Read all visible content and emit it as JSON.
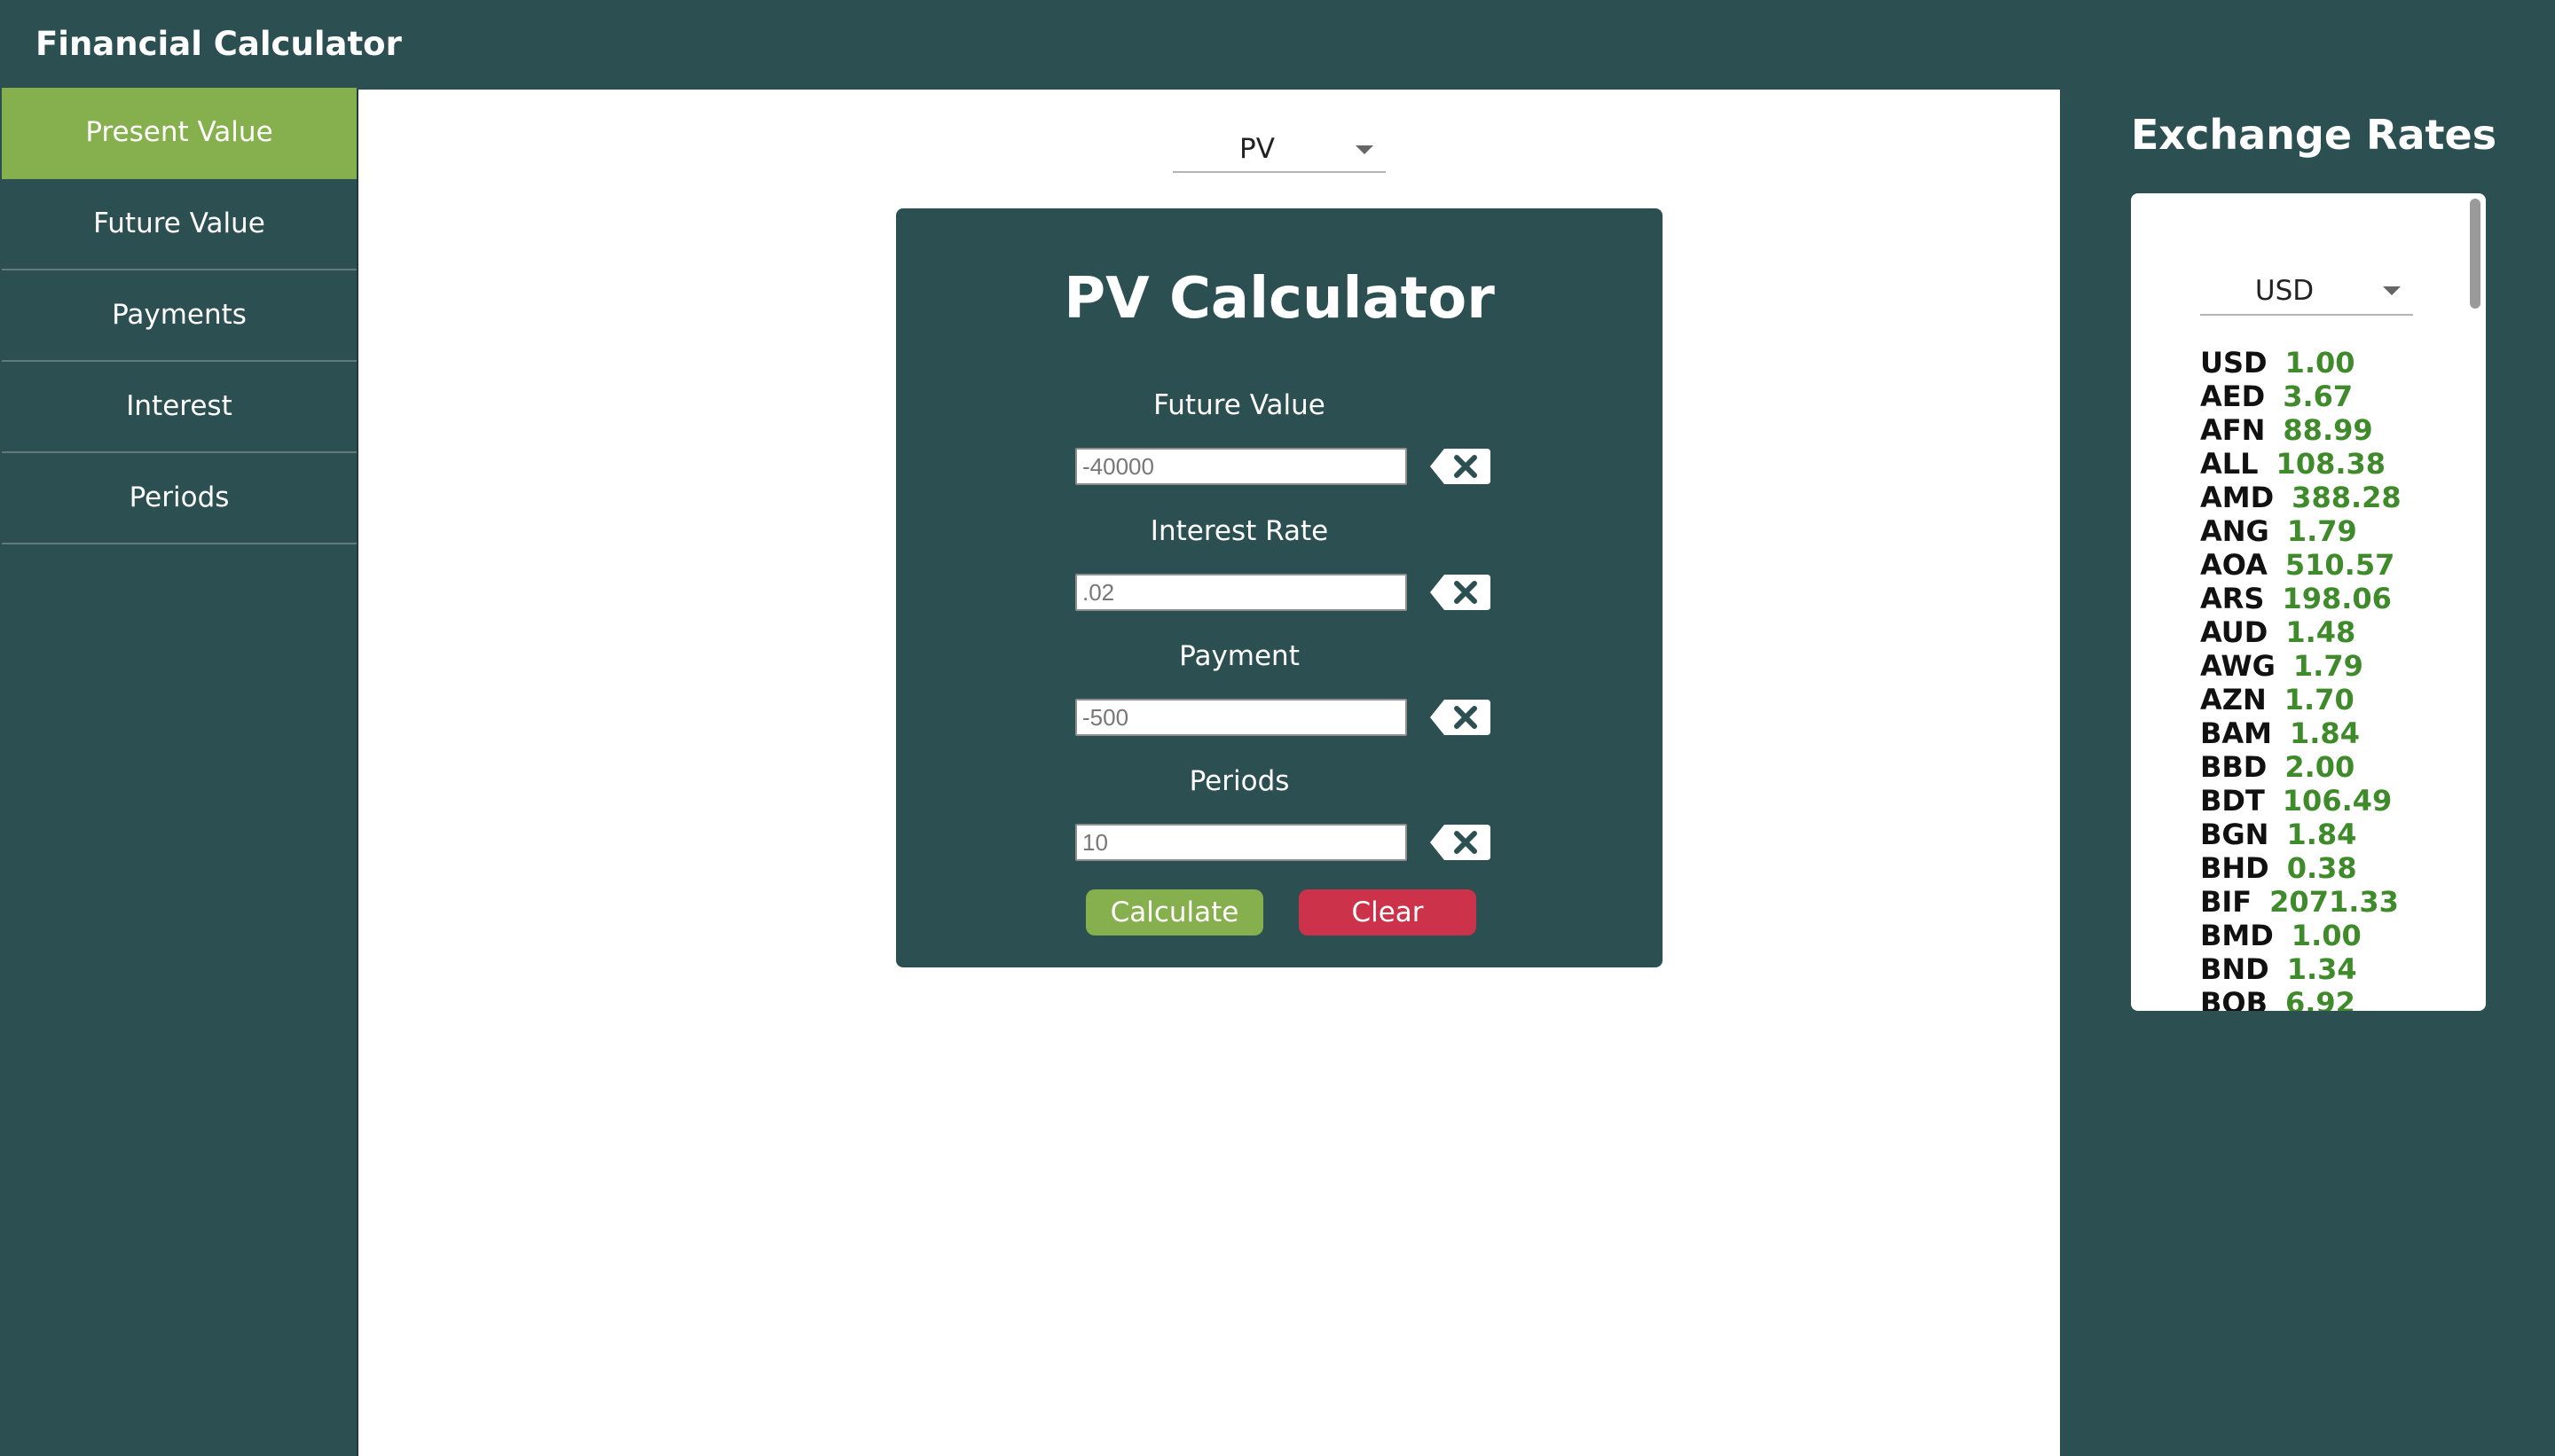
{
  "app": {
    "title": "Financial Calculator"
  },
  "sidebar": {
    "items": [
      {
        "label": "Present Value",
        "active": true
      },
      {
        "label": "Future Value",
        "active": false
      },
      {
        "label": "Payments",
        "active": false
      },
      {
        "label": "Interest",
        "active": false
      },
      {
        "label": "Periods",
        "active": false
      }
    ]
  },
  "calculator": {
    "selected_type": "PV",
    "title": "PV Calculator",
    "fields": [
      {
        "label": "Future Value",
        "value": "-40000"
      },
      {
        "label": "Interest Rate",
        "value": ".02"
      },
      {
        "label": "Payment",
        "value": "-500"
      },
      {
        "label": "Periods",
        "value": "10"
      }
    ],
    "clear_field_icon": "backspace-x-icon",
    "calculate_label": "Calculate",
    "clear_label": "Clear"
  },
  "exchange": {
    "title": "Exchange Rates",
    "base_currency": "USD",
    "rates": [
      {
        "code": "USD",
        "value": "1.00"
      },
      {
        "code": "AED",
        "value": "3.67"
      },
      {
        "code": "AFN",
        "value": "88.99"
      },
      {
        "code": "ALL",
        "value": "108.38"
      },
      {
        "code": "AMD",
        "value": "388.28"
      },
      {
        "code": "ANG",
        "value": "1.79"
      },
      {
        "code": "AOA",
        "value": "510.57"
      },
      {
        "code": "ARS",
        "value": "198.06"
      },
      {
        "code": "AUD",
        "value": "1.48"
      },
      {
        "code": "AWG",
        "value": "1.79"
      },
      {
        "code": "AZN",
        "value": "1.70"
      },
      {
        "code": "BAM",
        "value": "1.84"
      },
      {
        "code": "BBD",
        "value": "2.00"
      },
      {
        "code": "BDT",
        "value": "106.49"
      },
      {
        "code": "BGN",
        "value": "1.84"
      },
      {
        "code": "BHD",
        "value": "0.38"
      },
      {
        "code": "BIF",
        "value": "2071.33"
      },
      {
        "code": "BMD",
        "value": "1.00"
      },
      {
        "code": "BND",
        "value": "1.34"
      },
      {
        "code": "BOB",
        "value": "6.92"
      }
    ]
  },
  "colors": {
    "background": "#2c5052",
    "accent_green": "#86b04d",
    "danger_red": "#cc334a",
    "rate_value_green": "#3f8a2a"
  }
}
